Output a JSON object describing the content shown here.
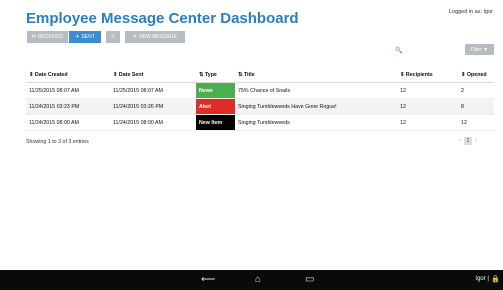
{
  "header": {
    "title": "Employee Message Center Dashboard",
    "logged_in": "Logged in as: Igor"
  },
  "toolbar": {
    "received_icon": "✉",
    "received_label": "RECEIVED",
    "sent_icon": "✈",
    "sent_label": "SENT",
    "refresh_icon": "↻",
    "new_icon": "✈",
    "new_label": "NEW MESSAGE"
  },
  "search": {
    "icon": "🔍",
    "value": "",
    "placeholder": ""
  },
  "filter": {
    "label": "Filter ▼"
  },
  "table": {
    "headers": [
      {
        "label": "⇕ Date Created"
      },
      {
        "label": "⇕ Date Sent"
      },
      {
        "label": "⇅ Type"
      },
      {
        "label": "⇅ Title"
      },
      {
        "label": "⇕ Recipients"
      },
      {
        "label": "⇕ Opened"
      }
    ],
    "rows": [
      {
        "created": "11/25/2015 08:07 AM",
        "sent": "11/25/2015 08:07 AM",
        "type": "News",
        "type_color": "#4cae4c",
        "title": "75% Chance of Snails",
        "recipients": "12",
        "opened": "2"
      },
      {
        "created": "11/24/2015 03:23 PM",
        "sent": "11/24/2015 03:26 PM",
        "type": "Alert",
        "type_color": "#e02b27",
        "title": "Singing Tumbleweeds Have Gone Rogue!",
        "recipients": "12",
        "opened": "8"
      },
      {
        "created": "11/24/2015 08:00 AM",
        "sent": "11/24/2015 08:00 AM",
        "type": "New Item",
        "type_color": "#000000",
        "title": "Singing Tumbleweeds",
        "recipients": "12",
        "opened": "12"
      }
    ]
  },
  "footer": {
    "info": "Showing 1 to 3 of 3 entries",
    "prev": "‹",
    "page": "1",
    "next": "›"
  },
  "navbar": {
    "back_icon": "⟵",
    "home_icon": "⌂",
    "recent_icon": "▭",
    "user": "Igor  |",
    "lock_icon": "🔒"
  }
}
